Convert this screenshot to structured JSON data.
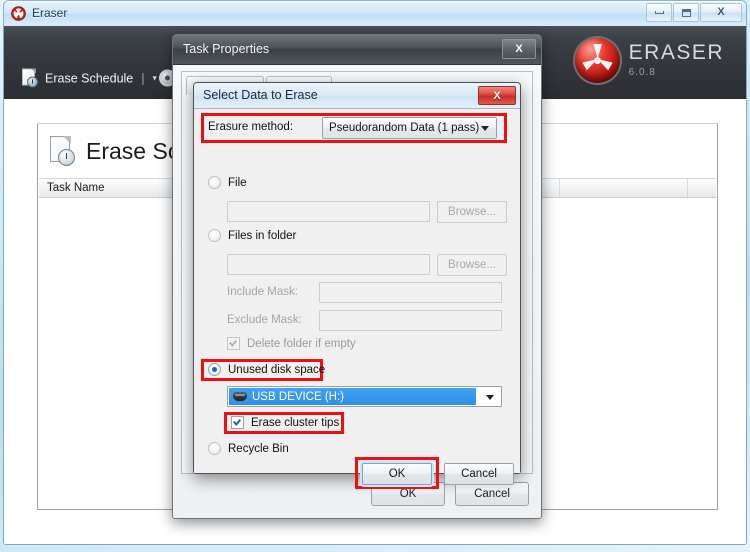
{
  "main_window": {
    "title": "Eraser",
    "title_icon": "radioactive-icon",
    "controls": {
      "minimize": "minimize-icon",
      "maximize": "maximize-icon",
      "close": "close-icon",
      "close_label": "X"
    },
    "toolbar": {
      "erase_schedule_label": "Erase Schedule",
      "separator": "|",
      "caret": "▾",
      "settings_label": ""
    },
    "logo": {
      "name": "ERASER",
      "version": "6.0.8"
    },
    "page": {
      "heading": "Erase Sch",
      "heading_full": "Erase Schedule",
      "columns": [
        "Task Name"
      ]
    }
  },
  "task_properties": {
    "title": "Task Properties",
    "close_label": "X",
    "tabs": [
      {
        "label": ""
      },
      {
        "label": ""
      }
    ],
    "buttons": {
      "ok": "OK",
      "cancel": "Cancel"
    }
  },
  "select_data": {
    "title": "Select Data to Erase",
    "close_label": "X",
    "erasure_method": {
      "label": "Erasure method:",
      "value": "Pseudorandom Data (1 pass)",
      "options": [
        "Pseudorandom Data (1 pass)"
      ]
    },
    "targets": {
      "file": {
        "label": "File",
        "selected": false,
        "path_value": "",
        "path_placeholder": "",
        "browse_label": "Browse..."
      },
      "files_in_folder": {
        "label": "Files in folder",
        "selected": false,
        "path_value": "",
        "path_placeholder": "",
        "browse_label": "Browse...",
        "include_mask_label": "Include Mask:",
        "include_mask_value": "",
        "exclude_mask_label": "Exclude Mask:",
        "exclude_mask_value": "",
        "delete_folder_label": "Delete folder if empty",
        "delete_folder_checked": true
      },
      "unused_disk_space": {
        "label": "Unused disk space",
        "selected": true,
        "drive_value": "USB DEVICE (H:)",
        "drive_icon": "drive-icon",
        "drive_options": [
          "USB DEVICE (H:)"
        ],
        "erase_cluster_tips_label": "Erase cluster tips",
        "erase_cluster_tips_checked": true
      },
      "recycle_bin": {
        "label": "Recycle Bin",
        "selected": false
      }
    },
    "buttons": {
      "ok": "OK",
      "cancel": "Cancel"
    }
  },
  "annotations": {
    "color": "#ef0e10",
    "boxes": [
      "erasure-method-row",
      "unused-disk-space-radio",
      "erase-cluster-tips-checkbox",
      "ok-button"
    ]
  }
}
